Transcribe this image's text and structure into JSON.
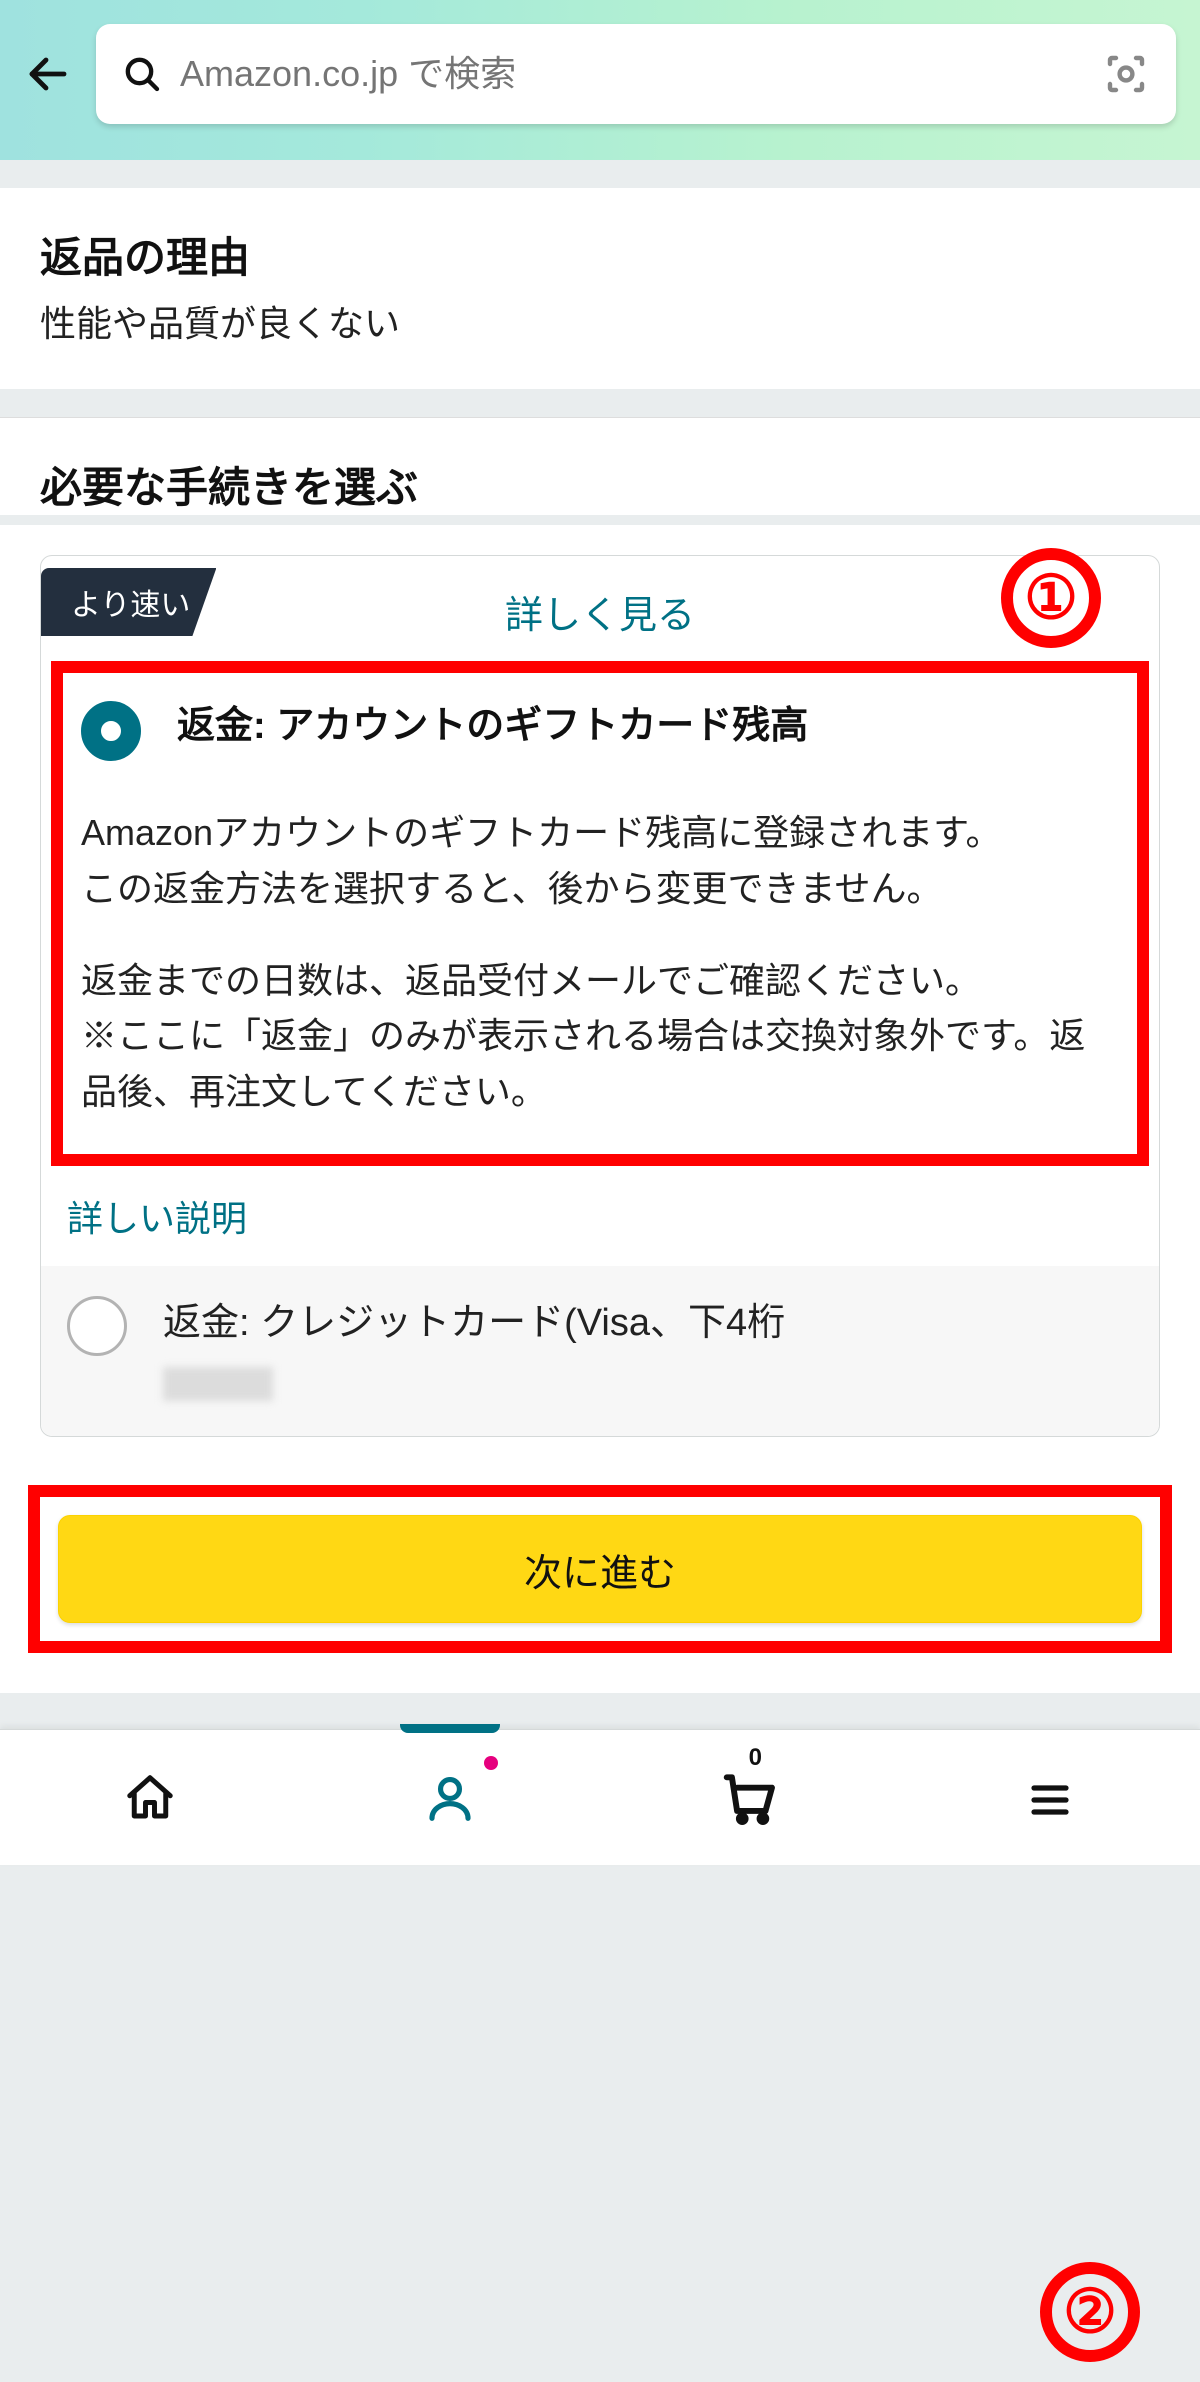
{
  "header": {
    "search_placeholder": "Amazon.co.jp で検索"
  },
  "reason": {
    "title": "返品の理由",
    "value": "性能や品質が良くない"
  },
  "procedure": {
    "title": "必要な手続きを選ぶ",
    "ribbon": "より速い",
    "learn_more": "詳しく見る",
    "option1": {
      "title": "返金: アカウントのギフトカード残高",
      "desc_p1": "Amazonアカウントのギフトカード残高に登録されます。\nこの返金方法を選択すると、後から変更できません。",
      "desc_p2": "返金までの日数は、返品受付メールでご確認ください。\n※ここに「返金」のみが表示される場合は交換対象外です。返品後、再注文してください。"
    },
    "more_info": "詳しい説明",
    "option2": {
      "title": "返金: クレジットカード(Visa、下4桁"
    }
  },
  "proceed_label": "次に進む",
  "callouts": {
    "one": "①",
    "two": "②"
  },
  "nav": {
    "cart_count": "0"
  },
  "colors": {
    "accent_teal": "#007185",
    "button_yellow": "#ffd814",
    "highlight_red": "#ff0000",
    "nav_dark": "#232f3e"
  }
}
